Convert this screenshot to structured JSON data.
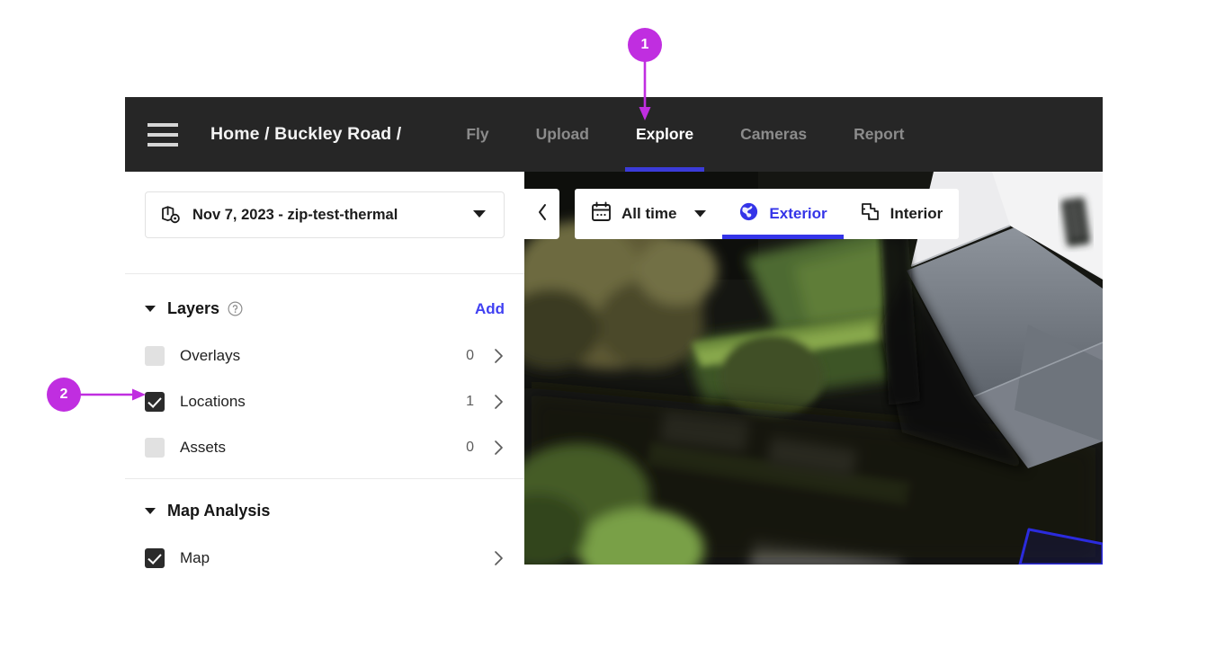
{
  "navbar": {
    "menu_icon": "hamburger-icon",
    "breadcrumb": "Home / Buckley Road /",
    "tabs": [
      {
        "label": "Fly",
        "active": false
      },
      {
        "label": "Upload",
        "active": false
      },
      {
        "label": "Explore",
        "active": true
      },
      {
        "label": "Cameras",
        "active": false
      },
      {
        "label": "Report",
        "active": false
      }
    ],
    "active_tab_underline_color": "#3b3bd8",
    "background_color": "#262626"
  },
  "sidebar": {
    "dataset_selector": {
      "icon": "map-pin-icon",
      "value": "Nov 7, 2023 - zip-test-thermal",
      "caret": "chevron-down-icon"
    },
    "sections": [
      {
        "title": "Layers",
        "help_icon": "help-circle-icon",
        "action_label": "Add",
        "action_color": "#4040f2",
        "expanded": true,
        "rows": [
          {
            "label": "Overlays",
            "checked": false,
            "count": "0",
            "chevron": "chevron-right-icon"
          },
          {
            "label": "Locations",
            "checked": true,
            "count": "1",
            "chevron": "chevron-right-icon"
          },
          {
            "label": "Assets",
            "checked": false,
            "count": "0",
            "chevron": "chevron-right-icon"
          }
        ]
      },
      {
        "title": "Map Analysis",
        "expanded": true,
        "rows": [
          {
            "label": "Map",
            "checked": true,
            "count": "",
            "chevron": "chevron-right-icon"
          }
        ]
      }
    ]
  },
  "viewer": {
    "collapse_button_icon": "chevron-left-icon",
    "toolbar": [
      {
        "label": "All time",
        "icon": "calendar-icon",
        "caret": "chevron-down-icon",
        "active": false
      },
      {
        "label": "Exterior",
        "icon": "globe-icon",
        "active": true
      },
      {
        "label": "Interior",
        "icon": "floorplan-icon",
        "active": false
      }
    ],
    "active_color": "#3434e8",
    "content_description": "Aerial drone photograph of a house roof, lawn, hedges and trees",
    "annotation_polygon_color": "#2b2bdd"
  },
  "callouts": [
    {
      "number": "1",
      "color": "#c02ee0",
      "points_to": "Explore tab"
    },
    {
      "number": "2",
      "color": "#c02ee0",
      "points_to": "Locations checkbox"
    }
  ]
}
